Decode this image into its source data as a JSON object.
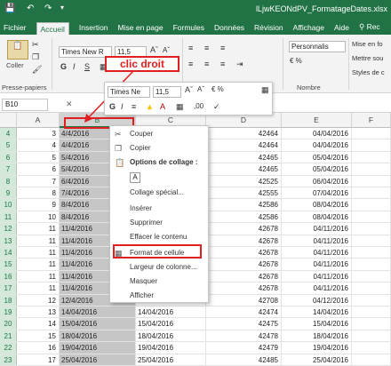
{
  "app": {
    "title": "lLjwKEONdPV_FormatageDates.xlsx",
    "accent": "#217346"
  },
  "menu": {
    "items": [
      "Fichier",
      "Accueil",
      "Insertion",
      "Mise en page",
      "Formules",
      "Données",
      "Révision",
      "Affichage",
      "Aide",
      "Rec"
    ]
  },
  "ribbon": {
    "paste_label": "Coller",
    "clipboard_group": "Presse-papiers",
    "font_name": "Times New R",
    "font_size": "11,5",
    "number_group": "Nombre",
    "number_format": "Personnalis",
    "merge_label": "Mise en fo",
    "wrap_label": "Mettre sou",
    "styles_label": "Styles de c"
  },
  "formula_bar": {
    "name_box": "B10",
    "fx": "fx"
  },
  "annotation": {
    "label": "clic droit"
  },
  "mini_toolbar": {
    "font_name": "Times Ne",
    "font_size": "11,5"
  },
  "context_menu": {
    "items": [
      "Couper",
      "Copier",
      "Options de collage :",
      "Collage spécial...",
      "Insérer",
      "Supprimer",
      "Effacer le contenu",
      "Format de cellule",
      "Largeur de colonne...",
      "Masquer",
      "Afficher"
    ]
  },
  "grid": {
    "columns": [
      "A",
      "B",
      "C",
      "D",
      "E",
      "F"
    ],
    "rows": [
      {
        "n": "4",
        "a": "3",
        "b": "4/4/2016",
        "d": "42464",
        "e": "04/04/2016"
      },
      {
        "n": "5",
        "a": "4",
        "b": "4/4/2016",
        "d": "42464",
        "e": "04/04/2016"
      },
      {
        "n": "6",
        "a": "5",
        "b": "5/4/2016",
        "d": "42465",
        "e": "05/04/2016"
      },
      {
        "n": "7",
        "a": "6",
        "b": "5/4/2016",
        "d": "42465",
        "e": "05/04/2016"
      },
      {
        "n": "8",
        "a": "7",
        "b": "6/4/2016",
        "d": "42525",
        "e": "06/04/2016"
      },
      {
        "n": "9",
        "a": "8",
        "b": "7/4/2016",
        "d": "42555",
        "e": "07/04/2016"
      },
      {
        "n": "10",
        "a": "9",
        "b": "8/4/2016",
        "d": "42586",
        "e": "08/04/2016"
      },
      {
        "n": "11",
        "a": "10",
        "b": "8/4/2016",
        "d": "42586",
        "e": "08/04/2016"
      },
      {
        "n": "12",
        "a": "11",
        "b": "11/4/2016",
        "d": "42678",
        "e": "04/11/2016"
      },
      {
        "n": "13",
        "a": "11",
        "b": "11/4/2016",
        "d": "42678",
        "e": "04/11/2016"
      },
      {
        "n": "14",
        "a": "11",
        "b": "11/4/2016",
        "d": "42678",
        "e": "04/11/2016"
      },
      {
        "n": "15",
        "a": "11",
        "b": "11/4/2016",
        "d": "42678",
        "e": "04/11/2016"
      },
      {
        "n": "16",
        "a": "11",
        "b": "11/4/2016",
        "d": "42678",
        "e": "04/11/2016"
      },
      {
        "n": "17",
        "a": "11",
        "b": "11/4/2016",
        "d": "42678",
        "e": "04/11/2016"
      },
      {
        "n": "18",
        "a": "12",
        "b": "12/4/2016",
        "d": "42708",
        "e": "04/12/2016"
      },
      {
        "n": "19",
        "a": "13",
        "b": "14/04/2016",
        "c": "14/04/2016",
        "d": "42474",
        "e": "14/04/2016"
      },
      {
        "n": "20",
        "a": "14",
        "b": "15/04/2016",
        "c": "15/04/2016",
        "d": "42475",
        "e": "15/04/2016"
      },
      {
        "n": "21",
        "a": "15",
        "b": "18/04/2016",
        "c": "18/04/2016",
        "d": "42478",
        "e": "18/04/2016"
      },
      {
        "n": "22",
        "a": "16",
        "b": "19/04/2016",
        "c": "19/04/2016",
        "d": "42479",
        "e": "19/04/2016"
      },
      {
        "n": "23",
        "a": "17",
        "b": "25/04/2016",
        "c": "25/04/2016",
        "d": "42485",
        "e": "25/04/2016"
      }
    ]
  }
}
